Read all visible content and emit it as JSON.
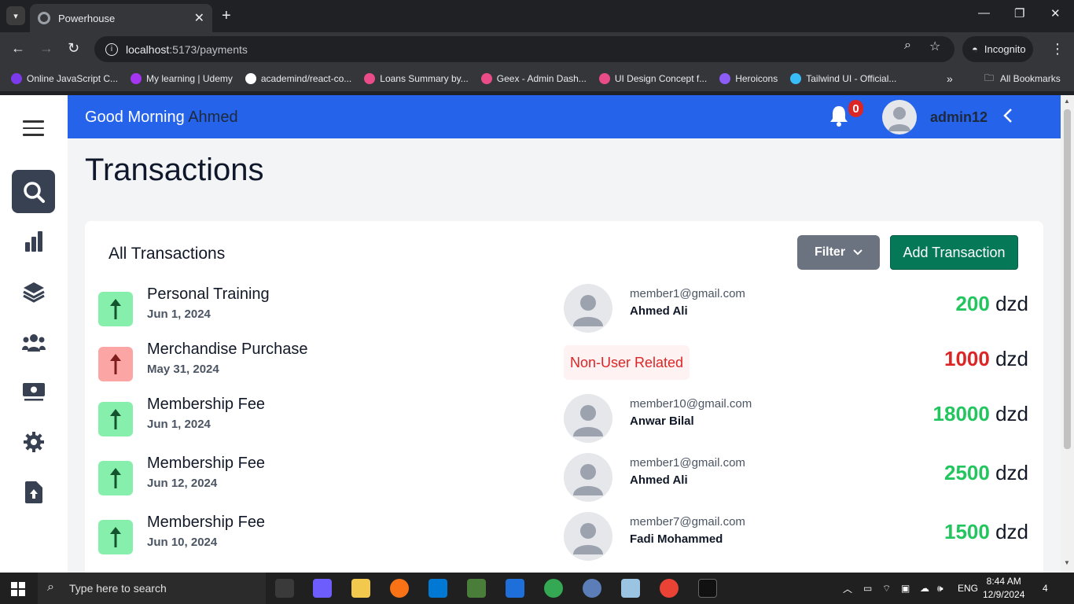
{
  "browser": {
    "tab_title": "Powerhouse",
    "url_host": "localhost",
    "url_path": ":5173/payments",
    "incognito_label": "Incognito",
    "bookmarks": [
      {
        "label": "Online JavaScript C...",
        "color": "#7c3aed"
      },
      {
        "label": "My learning | Udemy",
        "color": "#a435f0"
      },
      {
        "label": "academind/react-co...",
        "color": "#ffffff"
      },
      {
        "label": "Loans Summary by...",
        "color": "#ea4c89"
      },
      {
        "label": "Geex - Admin Dash...",
        "color": "#ea4c89"
      },
      {
        "label": "UI Design Concept f...",
        "color": "#ea4c89"
      },
      {
        "label": "Heroicons",
        "color": "#8b5cf6"
      },
      {
        "label": "Tailwind UI - Official...",
        "color": "#38bdf8"
      }
    ],
    "all_bookmarks_label": "All Bookmarks"
  },
  "header": {
    "greeting": "Good Morning",
    "greeting_name": "Ahmed",
    "notification_count": "0",
    "username": "admin12"
  },
  "page": {
    "title": "Transactions",
    "card_title": "All Transactions",
    "filter_label": "Filter",
    "add_label": "Add Transaction",
    "currency": "dzd",
    "non_user_label": "Non-User Related"
  },
  "transactions": [
    {
      "title": "Personal Training",
      "date": "Jun 1, 2024",
      "direction": "in",
      "email": "member1@gmail.com",
      "name": "Ahmed Ali",
      "amount": "200",
      "currency": "dzd"
    },
    {
      "title": "Merchandise Purchase",
      "date": "May 31, 2024",
      "direction": "out",
      "non_user": "Non-User Related",
      "amount": "1000",
      "currency": "dzd"
    },
    {
      "title": "Membership Fee",
      "date": "Jun 1, 2024",
      "direction": "in",
      "email": "member10@gmail.com",
      "name": "Anwar Bilal",
      "amount": "18000",
      "currency": "dzd"
    },
    {
      "title": "Membership Fee",
      "date": "Jun 12, 2024",
      "direction": "in",
      "email": "member1@gmail.com",
      "name": "Ahmed Ali",
      "amount": "2500",
      "currency": "dzd"
    },
    {
      "title": "Membership Fee",
      "date": "Jun 10, 2024",
      "direction": "in",
      "email": "member7@gmail.com",
      "name": "Fadi Mohammed",
      "amount": "1500",
      "currency": "dzd"
    }
  ],
  "taskbar": {
    "search_placeholder": "Type here to search",
    "language": "ENG",
    "time": "8:44 AM",
    "date": "12/9/2024",
    "notifications": "4"
  },
  "colors": {
    "primary": "#2563eb",
    "success": "#22c55e",
    "danger": "#dc2626",
    "add_button": "#047857"
  }
}
